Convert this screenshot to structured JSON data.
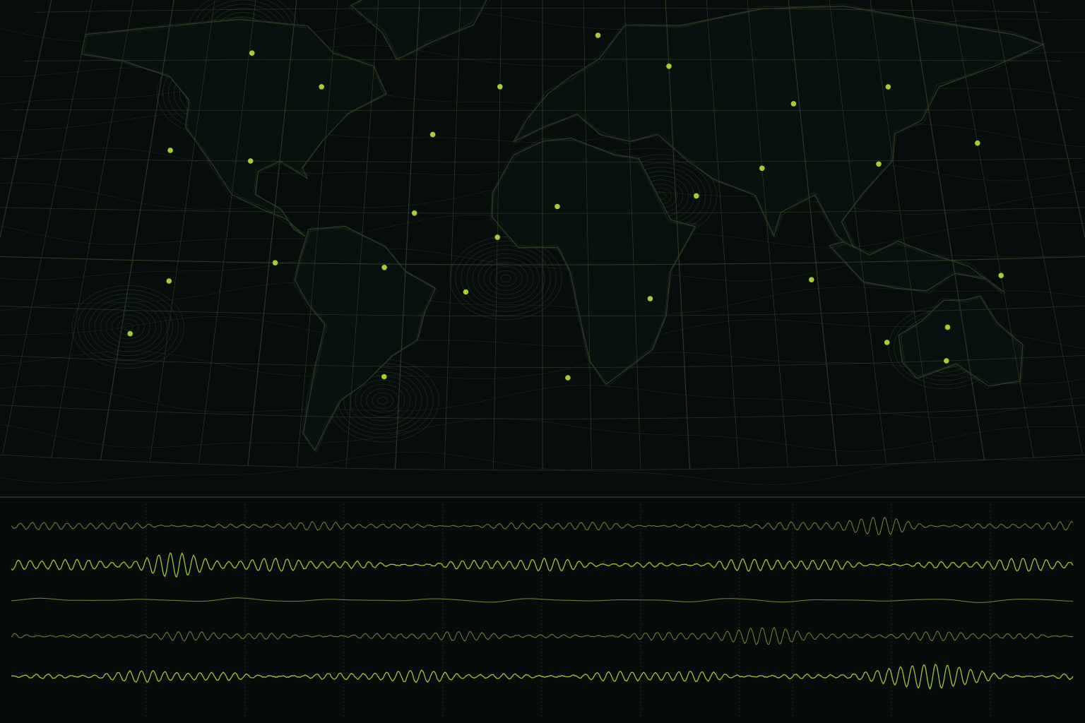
{
  "colors": {
    "background": "#060d0b",
    "graticule": "#2e3a24",
    "coastline": "#2f3f26",
    "contour": "#1c2a20",
    "station": "#a6cf2e",
    "trace_bright": "#9fc730",
    "trace_dim": "#6d8a3a"
  },
  "map": {
    "stations": [
      {
        "lon": -104,
        "lat": 62
      },
      {
        "lon": -78,
        "lat": 52
      },
      {
        "lon": -128,
        "lat": 33
      },
      {
        "lon": -100,
        "lat": 30
      },
      {
        "lon": -38,
        "lat": 38
      },
      {
        "lon": -15,
        "lat": 52
      },
      {
        "lon": 20,
        "lat": 67
      },
      {
        "lon": 45,
        "lat": 58
      },
      {
        "lon": 88,
        "lat": 47
      },
      {
        "lon": 122,
        "lat": 52
      },
      {
        "lon": 150,
        "lat": 35
      },
      {
        "lon": 115,
        "lat": 29
      },
      {
        "lon": 75,
        "lat": 28
      },
      {
        "lon": 52,
        "lat": 20
      },
      {
        "lon": 5,
        "lat": 17
      },
      {
        "lon": -43,
        "lat": 15
      },
      {
        "lon": -15,
        "lat": 8
      },
      {
        "lon": -88,
        "lat": 0
      },
      {
        "lon": -52,
        "lat": -1
      },
      {
        "lon": -122,
        "lat": -6
      },
      {
        "lon": -25,
        "lat": -8
      },
      {
        "lon": 35,
        "lat": -10
      },
      {
        "lon": 88,
        "lat": -5
      },
      {
        "lon": 150,
        "lat": -5
      },
      {
        "lon": -132,
        "lat": -22
      },
      {
        "lon": 110,
        "lat": -24
      },
      {
        "lon": 130,
        "lat": -20
      },
      {
        "lon": -50,
        "lat": -33
      },
      {
        "lon": 8,
        "lat": -33
      },
      {
        "lon": 128,
        "lat": -30
      }
    ]
  },
  "traces": [
    {
      "style": "dim",
      "amplitude": 0.45,
      "burst_at": 0.82
    },
    {
      "style": "bright",
      "amplitude": 0.7,
      "burst_at": 0.15
    },
    {
      "style": "dim",
      "amplitude": 0.25,
      "burst_at": null
    },
    {
      "style": "dim",
      "amplitude": 0.5,
      "burst_at": 0.72
    },
    {
      "style": "bright",
      "amplitude": 0.65,
      "burst_at": 0.87
    }
  ]
}
